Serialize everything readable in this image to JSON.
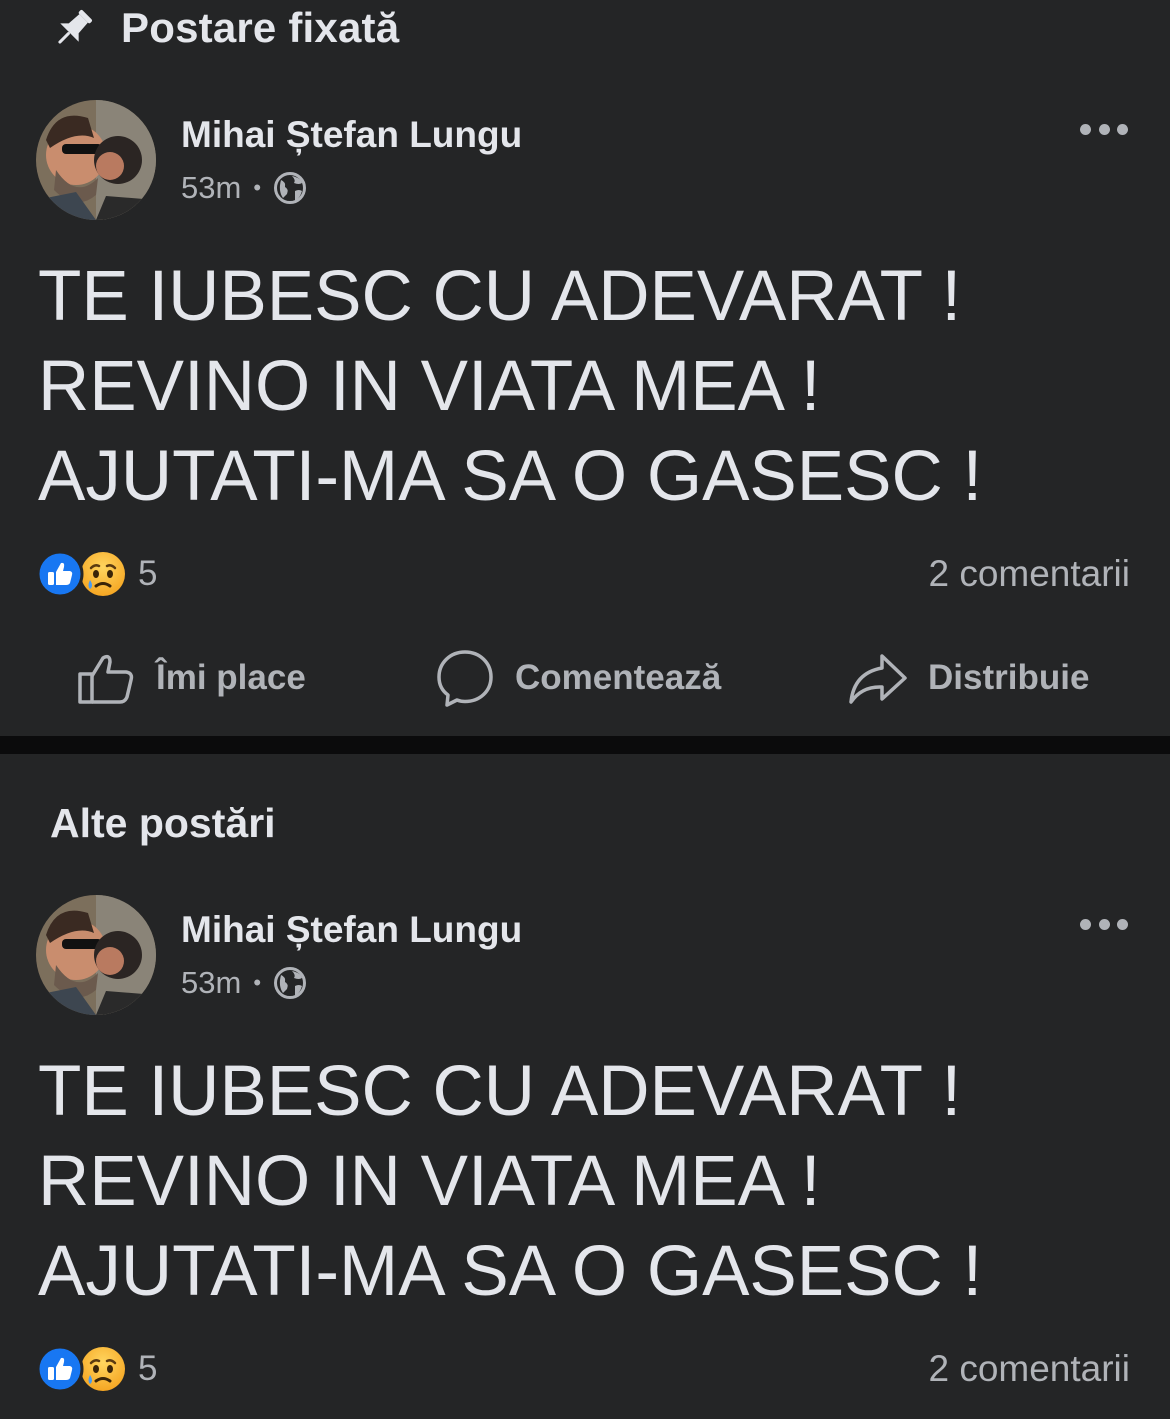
{
  "pinned": {
    "header_label": "Postare fixată"
  },
  "section": {
    "other_posts_label": "Alte postări"
  },
  "posts": [
    {
      "author": "Mihai Ștefan Lungu",
      "time": "53m",
      "audience_icon": "globe-icon",
      "text_lines": [
        "TE IUBESC CU ADEVARAT !",
        "REVINO IN VIATA MEA !",
        "AJUTATI-MA SA O GASESC !"
      ],
      "reactions": [
        "like",
        "sad"
      ],
      "reaction_count": "5",
      "comments": "2 comentarii"
    },
    {
      "author": "Mihai Ștefan Lungu",
      "time": "53m",
      "audience_icon": "globe-icon",
      "text_lines": [
        "TE IUBESC CU ADEVARAT !",
        "REVINO IN VIATA MEA !",
        "AJUTATI-MA SA O GASESC !"
      ],
      "reactions": [
        "like",
        "sad"
      ],
      "reaction_count": "5",
      "comments": "2 comentarii"
    }
  ],
  "actions": {
    "like": "Îmi place",
    "comment": "Comentează",
    "share": "Distribuie"
  },
  "colors": {
    "background": "#242526",
    "separator": "#0b0b0c",
    "primary_text": "#e4e6eb",
    "secondary_text": "#b0b3b8",
    "like_blue": "#1877f2",
    "sad_yellow": "#f7b125"
  }
}
